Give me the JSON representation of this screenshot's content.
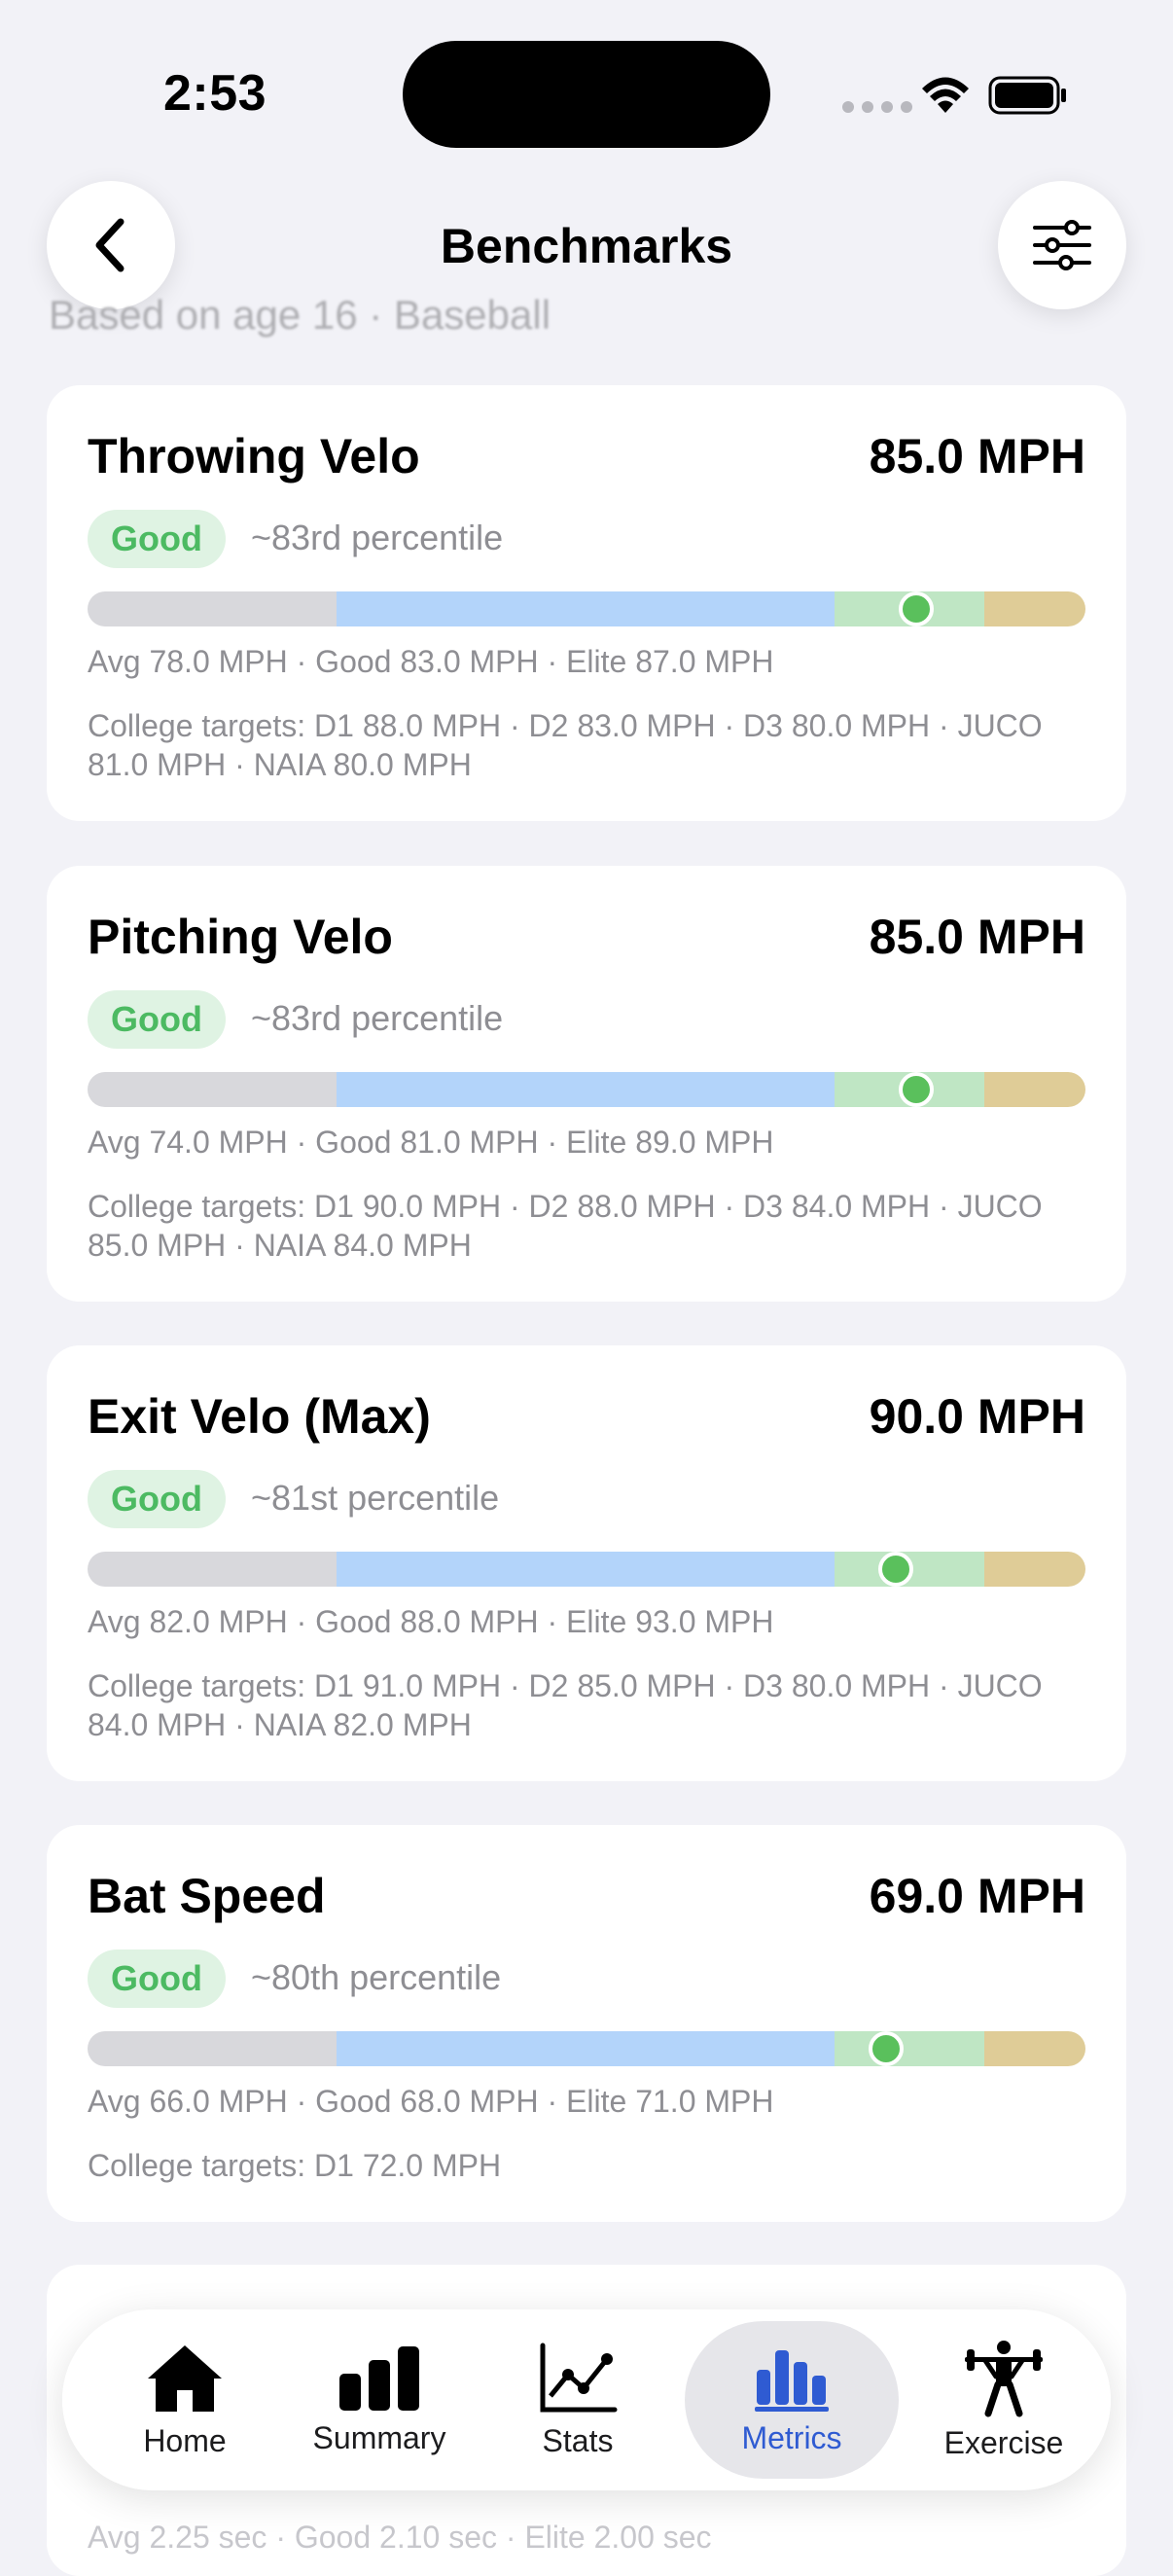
{
  "status_bar": {
    "time": "2:53"
  },
  "header": {
    "title": "Benchmarks",
    "subtitle": "Based on age 16 · Baseball"
  },
  "cards": [
    {
      "title": "Throwing Velo",
      "value": "85.0 MPH",
      "badge": "Good",
      "percentile": "~83rd percentile",
      "marker_fraction": 0.83,
      "stats": "Avg 78.0 MPH  ·  Good 83.0 MPH  ·  Elite 87.0 MPH",
      "targets": "College targets: D1 88.0 MPH  ·  D2 83.0 MPH  ·  D3 80.0 MPH  ·  JUCO 81.0 MPH  ·  NAIA 80.0 MPH"
    },
    {
      "title": "Pitching Velo",
      "value": "85.0 MPH",
      "badge": "Good",
      "percentile": "~83rd percentile",
      "marker_fraction": 0.83,
      "stats": "Avg 74.0 MPH  ·  Good 81.0 MPH  ·  Elite 89.0 MPH",
      "targets": "College targets: D1 90.0 MPH  ·  D2 88.0 MPH  ·  D3 84.0 MPH  ·  JUCO 85.0 MPH  ·  NAIA 84.0 MPH"
    },
    {
      "title": "Exit Velo (Max)",
      "value": "90.0 MPH",
      "badge": "Good",
      "percentile": "~81st percentile",
      "marker_fraction": 0.81,
      "stats": "Avg 82.0 MPH  ·  Good 88.0 MPH  ·  Elite 93.0 MPH",
      "targets": "College targets: D1 91.0 MPH  ·  D2 85.0 MPH  ·  D3 80.0 MPH  ·  JUCO 84.0 MPH  ·  NAIA 82.0 MPH"
    },
    {
      "title": "Bat Speed",
      "value": "69.0 MPH",
      "badge": "Good",
      "percentile": "~80th percentile",
      "marker_fraction": 0.8,
      "stats": "Avg 66.0 MPH  ·  Good 68.0 MPH  ·  Elite 71.0 MPH",
      "targets": "College targets: D1 72.0 MPH"
    }
  ],
  "partial_card": {
    "stats": "Avg 2.25 sec  ·  Good 2.10 sec  ·  Elite 2.00 sec"
  },
  "tabbar": {
    "items": [
      {
        "label": "Home",
        "icon": "house-icon"
      },
      {
        "label": "Summary",
        "icon": "bar-chart-icon"
      },
      {
        "label": "Stats",
        "icon": "line-chart-icon"
      },
      {
        "label": "Metrics",
        "icon": "metrics-chart-icon",
        "active": true
      },
      {
        "label": "Exercise",
        "icon": "weightlifting-icon"
      }
    ]
  },
  "colors": {
    "accent": "#2f5bd2",
    "good_green": "#4cba62",
    "bar_avg": "#d8d8dc",
    "bar_good": "#b3d4fa",
    "bar_elite": "#bfe6c4",
    "bar_top": "#dfcc97"
  }
}
